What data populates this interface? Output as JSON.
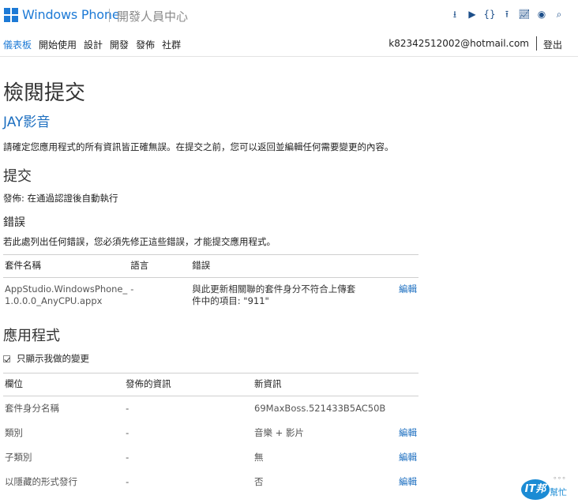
{
  "header": {
    "brand": "Windows Phone",
    "subtitle": "開發人員中心",
    "brand_color": "#1d7ad6",
    "tool_icons": [
      "download-icon",
      "play-icon",
      "code-braces-icon",
      "upload-icon",
      "chart-icon",
      "eye-icon",
      "search-icon"
    ]
  },
  "nav": {
    "items": [
      "儀表板",
      "開始使用",
      "設計",
      "開發",
      "發佈",
      "社群"
    ],
    "account": "k82342512002@hotmail.com",
    "logout": "登出"
  },
  "page": {
    "title": "檢閱提交",
    "app_name": "JAY影音",
    "intro": "請確定您應用程式的所有資訊皆正確無誤。在提交之前，您可以返回並編輯任何需要變更的內容。"
  },
  "submission": {
    "heading": "提交",
    "text": "發佈: 在通過認證後自動執行"
  },
  "errors": {
    "heading": "錯誤",
    "text": "若此處列出任何錯誤，您必須先修正這些錯誤，才能提交應用程式。",
    "columns": [
      "套件名稱",
      "語言",
      "錯誤"
    ],
    "rows": [
      {
        "package_line1": "AppStudio.WindowsPhone_",
        "package_line2": "1.0.0.0_AnyCPU.appx",
        "language": "-",
        "error_line1": "與此更新相關聯的套件身分不符合上傳套",
        "error_line2": "件中的項目: \"911\"",
        "action": "編輯"
      }
    ]
  },
  "app": {
    "heading": "應用程式",
    "checkbox_label": "只顯示我做的變更",
    "columns": [
      "欄位",
      "發佈的資訊",
      "新資訊"
    ],
    "rows": [
      {
        "field": "套件身分名稱",
        "published": "-",
        "new": "69MaxBoss.521433B5AC50B",
        "action": ""
      },
      {
        "field": "類別",
        "published": "-",
        "new": "音樂 + 影片",
        "action": "編輯"
      },
      {
        "field": "子類別",
        "published": "-",
        "new": "無",
        "action": "編輯"
      },
      {
        "field": "以隱藏的形式發行",
        "published": "-",
        "new": "否",
        "action": "編輯"
      }
    ]
  },
  "watermark": {
    "bubble": "IT邦",
    "text": "幫忙"
  }
}
